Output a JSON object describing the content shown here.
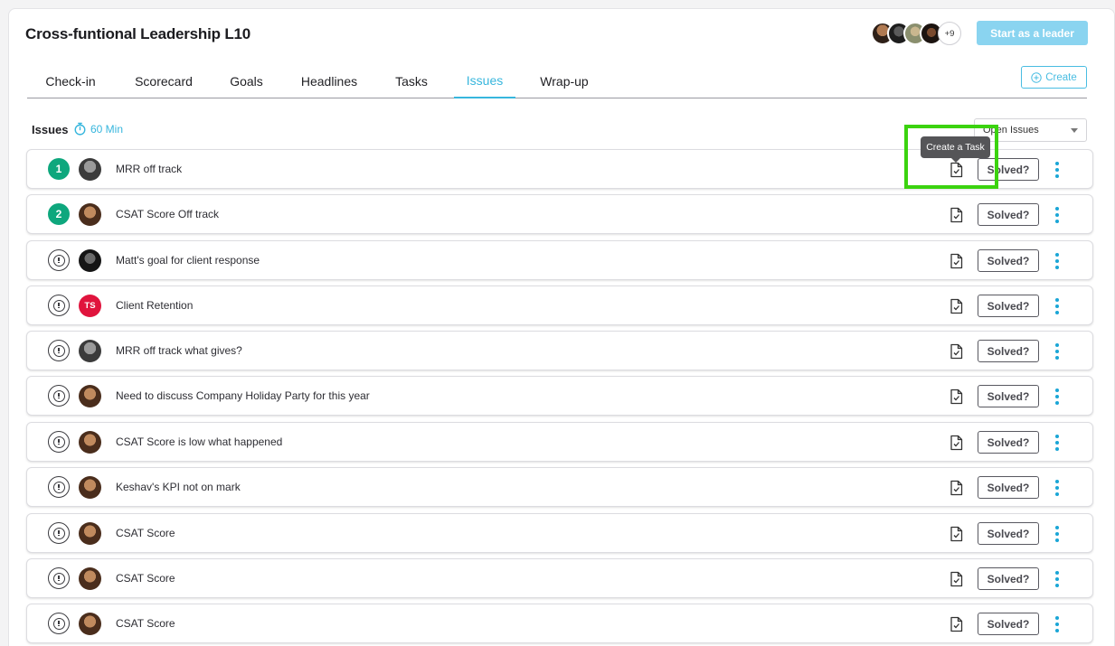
{
  "header": {
    "title": "Cross-funtional Leadership L10",
    "attendees_more": "+9",
    "leader_button": "Start as a leader"
  },
  "tabs": [
    {
      "label": "Check-in"
    },
    {
      "label": "Scorecard"
    },
    {
      "label": "Goals"
    },
    {
      "label": "Headlines"
    },
    {
      "label": "Tasks"
    },
    {
      "label": "Issues",
      "active": true
    },
    {
      "label": "Wrap-up"
    }
  ],
  "create_button": "Create",
  "issues_section": {
    "label": "Issues",
    "timer": "60 Min",
    "filter_value": "Open Issues"
  },
  "tooltip": "Create a Task",
  "solved_label": "Solved?",
  "issues": [
    {
      "rank": "1",
      "owner": "photo-a",
      "text": "MRR off track"
    },
    {
      "rank": "2",
      "owner": "photo-b",
      "text": "CSAT Score Off track"
    },
    {
      "rank": "",
      "owner": "photo-c",
      "text": "Matt's goal for client response"
    },
    {
      "rank": "",
      "owner": "TS",
      "text": "Client Retention"
    },
    {
      "rank": "",
      "owner": "photo-a",
      "text": "MRR off track what gives?"
    },
    {
      "rank": "",
      "owner": "photo-b",
      "text": "Need to discuss Company Holiday Party for this year"
    },
    {
      "rank": "",
      "owner": "photo-b",
      "text": "CSAT Score is low what happened"
    },
    {
      "rank": "",
      "owner": "photo-b",
      "text": "Keshav's KPI not on mark"
    },
    {
      "rank": "",
      "owner": "photo-b",
      "text": "CSAT Score"
    },
    {
      "rank": "",
      "owner": "photo-b",
      "text": "CSAT Score"
    },
    {
      "rank": "",
      "owner": "photo-b",
      "text": "CSAT Score"
    }
  ],
  "colors": {
    "accent": "#37b6dd",
    "rank_badge": "#0ea77d",
    "initials_avatar": "#e0143d",
    "highlight": "#3bd30f"
  }
}
